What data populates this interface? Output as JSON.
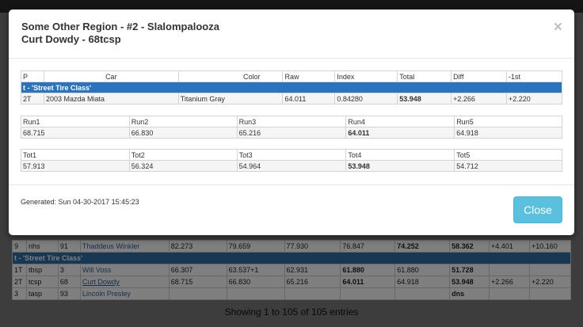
{
  "modal": {
    "title_line1": "Some Other Region - #2 - Slalompalooza",
    "title_line2": "Curt Dowdy - 68tcsp",
    "close_x": "×",
    "result": {
      "headers": [
        "P",
        "Car",
        "Color",
        "Raw",
        "Index",
        "Total",
        "Diff",
        "-1st"
      ],
      "class_label": "t - 'Street Tire Class'",
      "row": [
        "2T",
        "2003 Mazda Miata",
        "Titanium Gray",
        "64.011",
        "0.84280",
        "53.948",
        "+2.266",
        "+2.220"
      ]
    },
    "runs": {
      "headers": [
        "Run1",
        "Run2",
        "Run3",
        "Run4",
        "Run5"
      ],
      "values": [
        "68.715",
        "66.830",
        "65.216",
        "64.011",
        "64.918"
      ]
    },
    "totals": {
      "headers": [
        "Tot1",
        "Tot2",
        "Tot3",
        "Tot4",
        "Tot5"
      ],
      "values": [
        "57.913",
        "56.324",
        "54.964",
        "53.948",
        "54.712"
      ]
    },
    "generated": "Generated: Sun 04-30-2017 15:45:23",
    "close_button": "Close"
  },
  "background": {
    "rows": [
      [
        "9",
        "nhs",
        "91",
        "Thaddeus Winkler",
        "82.273",
        "79.659",
        "77.930",
        "76.847",
        "74.252",
        "58.362",
        "+4.401",
        "+10.160"
      ],
      [
        "1T",
        "tbsp",
        "3",
        "Will Voss",
        "66.307",
        "63.537+1",
        "62.931",
        "61.880",
        "61.880",
        "51.728",
        "",
        ""
      ],
      [
        "2T",
        "tcsp",
        "68",
        "Curt Dowdy",
        "68.715",
        "66.830",
        "65.216",
        "64.011",
        "64.918",
        "53.948",
        "+2.266",
        "+2.220"
      ],
      [
        "3",
        "tasp",
        "93",
        "Lincoln Presley",
        "",
        "",
        "",
        "",
        "",
        "dns",
        "",
        ""
      ]
    ],
    "class_label": "t - 'Street Tire Class'",
    "footer": "Showing 1 to 105 of 105 entries"
  }
}
